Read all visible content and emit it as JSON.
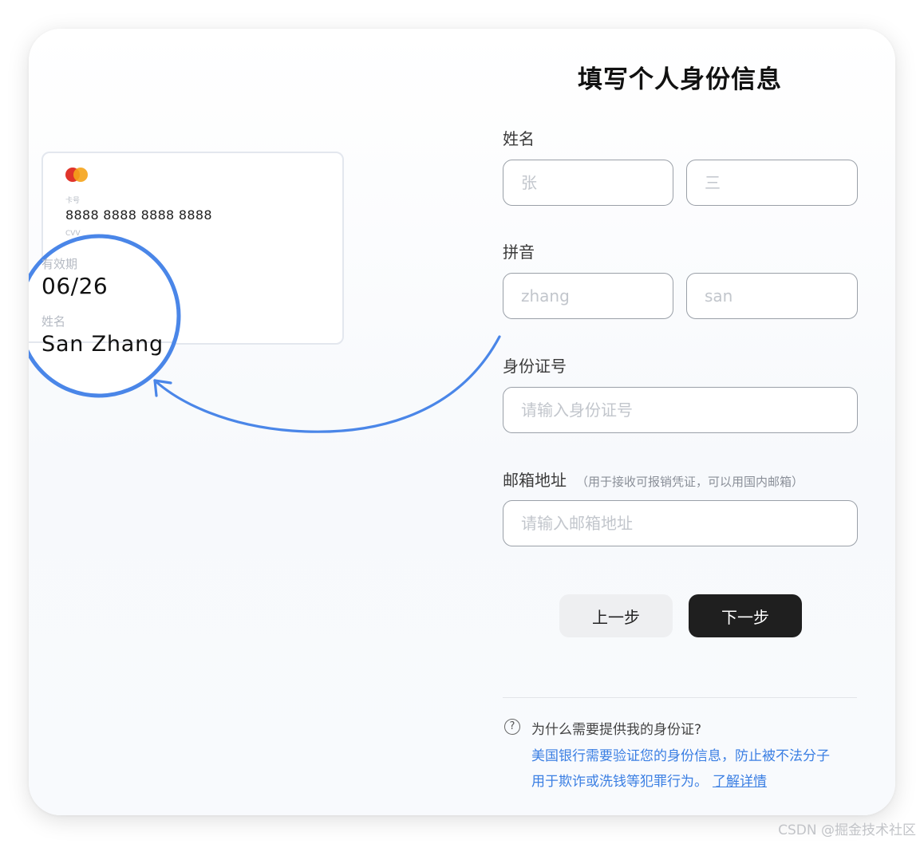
{
  "card": {
    "number_label": "卡号",
    "number": "8888 8888 8888 8888",
    "cvv_label": "CVV",
    "expiry_label": "有效期",
    "expiry": "06/26",
    "name_label": "姓名",
    "name": "San Zhang"
  },
  "form": {
    "title": "填写个人身份信息",
    "name_label": "姓名",
    "surname_placeholder": "张",
    "given_placeholder": "三",
    "pinyin_label": "拼音",
    "pinyin_surname_placeholder": "zhang",
    "pinyin_given_placeholder": "san",
    "id_label": "身份证号",
    "id_placeholder": "请输入身份证号",
    "email_label": "邮箱地址",
    "email_note": "（用于接收可报销凭证，可以用国内邮箱）",
    "email_placeholder": "请输入邮箱地址"
  },
  "actions": {
    "prev_label": "上一步",
    "next_label": "下一步"
  },
  "help": {
    "icon": "question-circle-icon",
    "question": "为什么需要提供我的身份证?",
    "answer_line1": "美国银行需要验证您的身份信息，防止被不法分子",
    "answer_line2": "用于欺诈或洗钱等犯罪行为。",
    "link": "了解详情"
  },
  "watermark": "CSDN @掘金技术社区",
  "colors": {
    "accent_blue": "#4a86e8",
    "link_blue": "#3b7fe3",
    "primary_button": "#1f1f1f",
    "secondary_button": "#eeeff1",
    "mastercard_red": "#e0342b",
    "mastercard_orange": "#f5a31a"
  }
}
